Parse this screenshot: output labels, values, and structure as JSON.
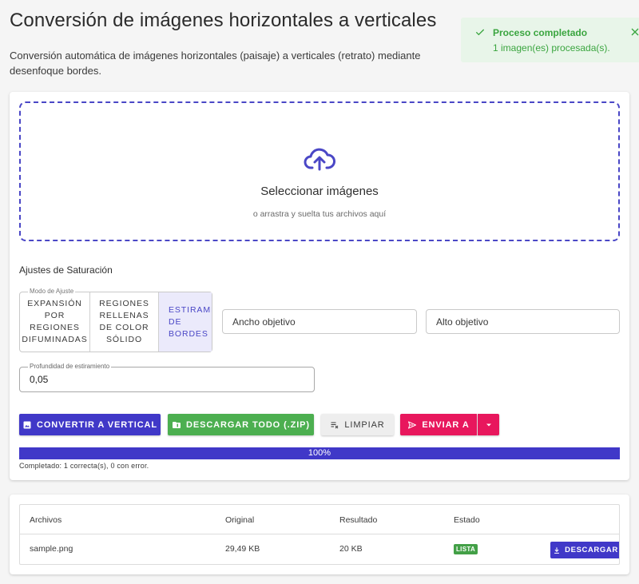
{
  "header": {
    "title": "Conversión de imágenes horizontales a verticales",
    "description": "Conversión automática de imágenes horizontales (paisaje) a verticales (retrato) mediante desenfoque bordes."
  },
  "toast": {
    "title": "Proceso completado",
    "message": "1 imagen(es) procesada(s).",
    "color": "#3aa53f",
    "background": "#e8f5e9"
  },
  "dropzone": {
    "title": "Seleccionar imágenes",
    "subtitle": "o arrastra y suelta tus archivos aquí",
    "icon": "cloud-upload-icon"
  },
  "settings": {
    "section_title": "Ajustes de Saturación",
    "mode_legend": "Modo de Ajuste",
    "modes": [
      {
        "label": "EXPANSIÓN\nPOR\nREGIONES\nDIFUMINADAS",
        "selected": false
      },
      {
        "label": "REGIONES\nRELLENAS\nDE COLOR\nSÓLIDO",
        "selected": false
      },
      {
        "label": "ESTIRAMI\nDE\nBORDES",
        "selected": true
      }
    ],
    "width_placeholder": "Ancho objetivo",
    "height_placeholder": "Alto objetivo",
    "depth_legend": "Profundidad de estiramiento",
    "depth_value": "0,05"
  },
  "actions": {
    "convert_label": "CONVERTIR A VERTICAL",
    "download_all_label": "DESCARGAR TODO (.ZIP)",
    "clear_label": "LIMPIAR",
    "send_label": "ENVIAR A"
  },
  "progress": {
    "percent": 100,
    "label": "100%",
    "note": "Completado: 1 correcta(s), 0 con error."
  },
  "results": {
    "columns": [
      "Archivos",
      "Original",
      "Resultado",
      "Estado"
    ],
    "rows": [
      {
        "file": "sample.png",
        "original": "29,49 KB",
        "result": "20 KB",
        "status": "LISTA",
        "download_label": "DESCARGAR"
      }
    ]
  },
  "colors": {
    "primary": "#4038c8",
    "success": "#4caf50",
    "accent": "#e8175d"
  }
}
